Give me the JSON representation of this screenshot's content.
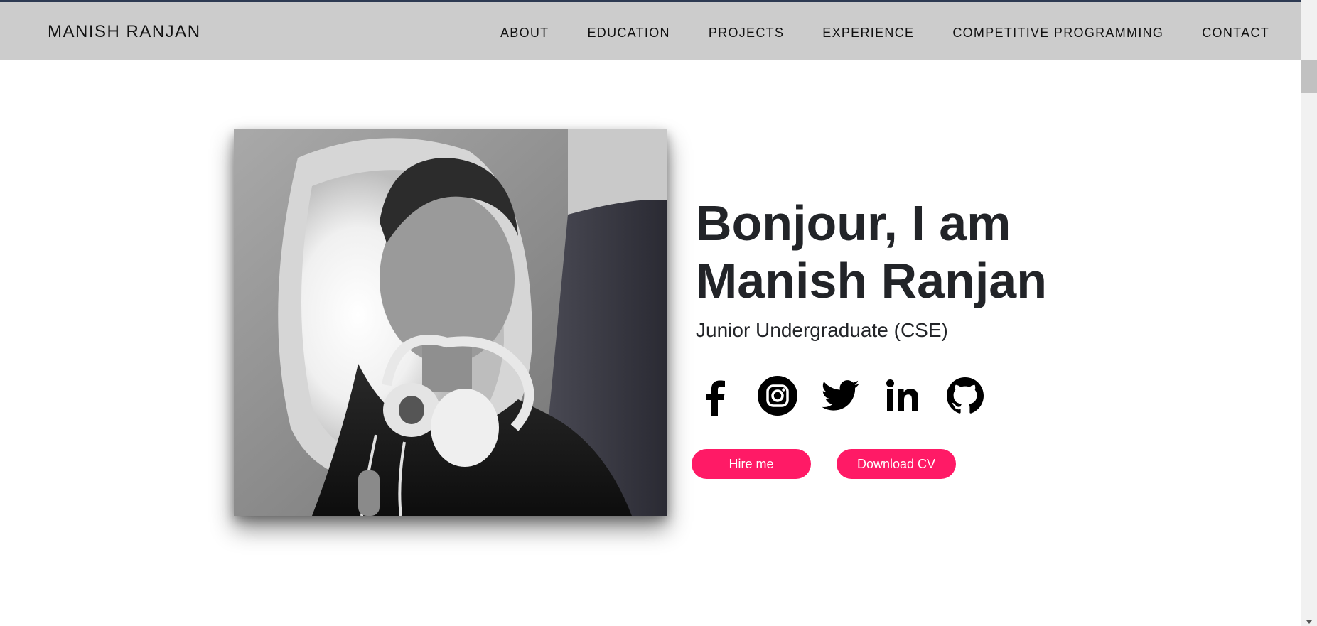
{
  "brand": "MANISH RANJAN",
  "nav": {
    "items": [
      "ABOUT",
      "EDUCATION",
      "PROJECTS",
      "EXPERIENCE",
      "COMPETITIVE PROGRAMMING",
      "CONTACT"
    ]
  },
  "hero": {
    "greeting_line1": "Bonjour, I am",
    "greeting_line2": "Manish Ranjan",
    "subtitle": "Junior Undergraduate (CSE)",
    "socials": [
      "facebook-icon",
      "instagram-icon",
      "twitter-icon",
      "linkedin-icon",
      "github-icon"
    ],
    "hire_label": "Hire me",
    "cv_label": "Download CV",
    "accent_color": "#ff1a66"
  }
}
